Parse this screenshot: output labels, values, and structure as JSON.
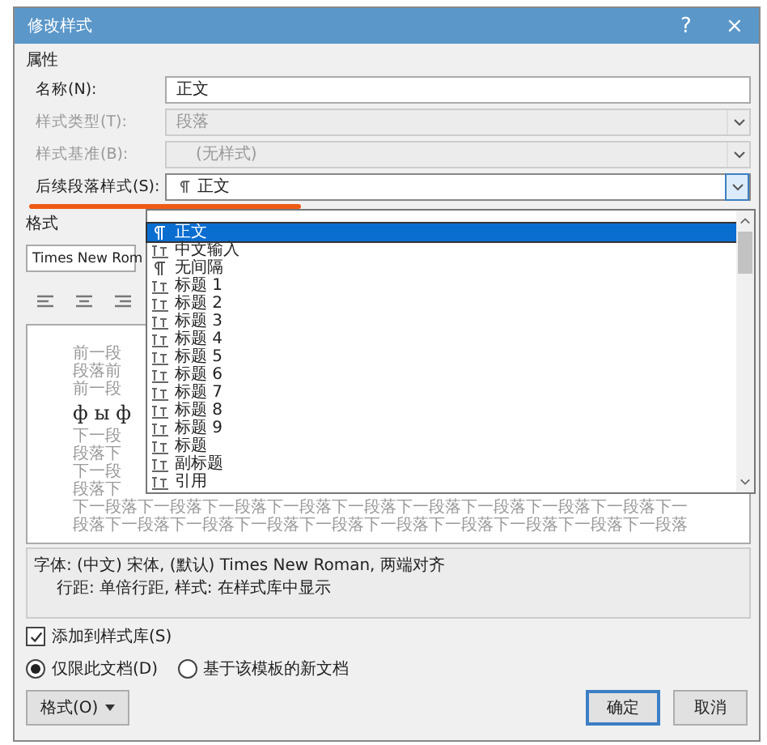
{
  "window": {
    "title": "修改样式",
    "help": "?",
    "close": "×"
  },
  "section_label": "属性",
  "properties": [
    {
      "label": "名称(N):",
      "value": "正文",
      "disabled": false,
      "kind": "text"
    },
    {
      "label": "样式类型(T):",
      "value": "段落",
      "disabled": true,
      "kind": "select"
    },
    {
      "label": "样式基准(B):",
      "value": "(无样式)",
      "disabled": true,
      "kind": "select"
    },
    {
      "label": "后续段落样式(S):",
      "value": "正文",
      "disabled": false,
      "kind": "select",
      "open": true
    }
  ],
  "dropdown": {
    "items": [
      {
        "kind": "paragraph",
        "label": "正文",
        "selected": true
      },
      {
        "kind": "linked",
        "label": "中文输入",
        "selected": false
      },
      {
        "kind": "paragraph",
        "label": "无间隔",
        "selected": false
      },
      {
        "kind": "linked",
        "label": "标题 1",
        "selected": false
      },
      {
        "kind": "linked",
        "label": "标题 2",
        "selected": false
      },
      {
        "kind": "linked",
        "label": "标题 3",
        "selected": false
      },
      {
        "kind": "linked",
        "label": "标题 4",
        "selected": false
      },
      {
        "kind": "linked",
        "label": "标题 5",
        "selected": false
      },
      {
        "kind": "linked",
        "label": "标题 6",
        "selected": false
      },
      {
        "kind": "linked",
        "label": "标题 7",
        "selected": false
      },
      {
        "kind": "linked",
        "label": "标题 8",
        "selected": false
      },
      {
        "kind": "linked",
        "label": "标题 9",
        "selected": false
      },
      {
        "kind": "linked",
        "label": "标题",
        "selected": false
      },
      {
        "kind": "linked",
        "label": "副标题",
        "selected": false
      },
      {
        "kind": "linked",
        "label": "引用",
        "selected": false
      }
    ]
  },
  "format_label": "格式",
  "font": "Times New Rom",
  "preview": [
    {
      "kind": "gray",
      "text": "前一段"
    },
    {
      "kind": "gray",
      "text": "段落前"
    },
    {
      "kind": "gray",
      "text": "前一段"
    },
    {
      "kind": "sample",
      "text": "ф ы ф"
    },
    {
      "kind": "gray",
      "text": "下一段"
    },
    {
      "kind": "gray",
      "text": "段落下"
    },
    {
      "kind": "gray",
      "text": "下一段"
    },
    {
      "kind": "gray",
      "text": "段落下"
    },
    {
      "kind": "gray",
      "text": "下一段落下一段落下一段落下一段落下一段落下一段落下一段落下一段落下一段落下一"
    },
    {
      "kind": "gray",
      "text": "段落下一段落下一段落下一段落下一段落下一段落下一段落下一段落下一段落下一段落"
    }
  ],
  "description": [
    "字体: (中文) 宋体, (默认) Times New Roman, 两端对齐",
    "行距: 单倍行距, 样式: 在样式库中显示"
  ],
  "add_to_library": {
    "label": "添加到样式库(S)",
    "checked": true
  },
  "scope": [
    {
      "label": "仅限此文档(D)",
      "selected": true
    },
    {
      "label": "基于该模板的新文档",
      "selected": false
    }
  ],
  "format_button": "格式(O)",
  "buttons": [
    "确定",
    "取消"
  ]
}
